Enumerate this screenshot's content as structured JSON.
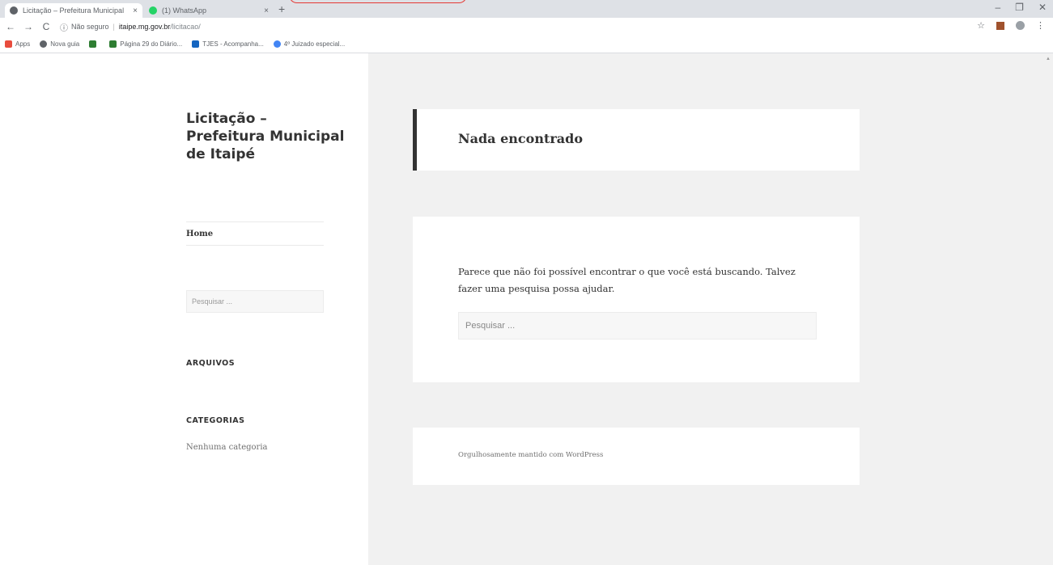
{
  "browser": {
    "tabs": [
      {
        "label": "Licitação – Prefeitura Municipal",
        "close": "×",
        "favicon_color": "#5f6368"
      },
      {
        "label": "(1) WhatsApp",
        "close": "×",
        "favicon_color": "#25d366"
      }
    ],
    "new_tab": "+",
    "window_controls": {
      "minimize": "–",
      "maximize": "❐",
      "close": "✕"
    },
    "nav": {
      "back": "←",
      "forward": "→",
      "reload": "C"
    },
    "omnibox": {
      "security_icon": "ⓘ",
      "security_label": "Não seguro",
      "separator": "|",
      "host": "itaipe.mg.gov.br",
      "path": "/licitacao/"
    },
    "toolbar_right": {
      "star": "☆",
      "menu": "⋮"
    },
    "bookmarks": [
      {
        "label": "Apps",
        "icon_color": "#e84c3d"
      },
      {
        "label": "Nova guia",
        "icon_color": "#5f6368"
      },
      {
        "label": "",
        "icon_color": "#2e7d32"
      },
      {
        "label": "Página 29 do Diário...",
        "icon_color": "#2e7d32"
      },
      {
        "label": "TJES - Acompanha...",
        "icon_color": "#1565c0"
      },
      {
        "label": "4º Juizado especial...",
        "icon_color": "#4285f4"
      }
    ]
  },
  "sidebar": {
    "site_title": "Licitação – Prefeitura Municipal de Itaipé",
    "menu_home": "Home",
    "search_placeholder": "Pesquisar ...",
    "widgets": {
      "arquivos": "ARQUIVOS",
      "categorias": "CATEGORIAS",
      "categorias_empty": "Nenhuma categoria"
    }
  },
  "main": {
    "header_title": "Nada encontrado",
    "message": "Parece que não foi possível encontrar o que você está buscando. Talvez fazer uma pesquisa possa ajudar.",
    "search_placeholder": "Pesquisar ...",
    "footer_credits": "Orgulhosamente mantido com WordPress"
  },
  "colors": {
    "page_background": "#f1f1f1",
    "card_background": "#ffffff",
    "header_accent": "#333333",
    "annotation": "#e53935"
  }
}
